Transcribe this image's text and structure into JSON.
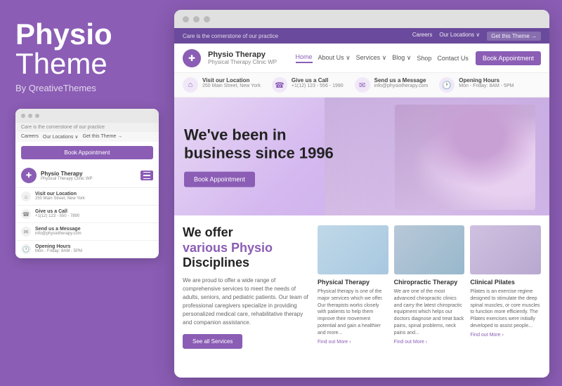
{
  "brand": {
    "physio": "Physio",
    "theme": "Theme",
    "by": "By QreativeThemes"
  },
  "mini_browser": {
    "topbar_text": "Care is the cornerstone of our practice",
    "nav_items": [
      "Careers",
      "Our Locations ∨",
      "Get this Theme →"
    ],
    "book_btn": "Book Appointment",
    "logo_name": "Physio Therapy",
    "logo_sub": "Physical Therapy Clinic WP",
    "info_rows": [
      {
        "label": "Visit our Location",
        "value": "250 Main Street, New York"
      },
      {
        "label": "Give us a Call",
        "value": "+1(12) 123 - 550 - 7890"
      },
      {
        "label": "Send us a Message",
        "value": "info@physiotherapy.com"
      },
      {
        "label": "Opening Hours",
        "value": "Mon - Friday: 8AM - 5PM"
      }
    ]
  },
  "main_site": {
    "topbar": {
      "tagline": "Care is the cornerstone of our practice",
      "nav": [
        "Careers",
        "Our Locations ∨",
        "Get this Theme →"
      ]
    },
    "header": {
      "logo_name": "Physio Therapy",
      "logo_sub": "Physical Therapy Clinic WP",
      "nav": [
        "Home",
        "About Us ∨",
        "Services ∨",
        "Blog ∨",
        "Shop",
        "Contact Us"
      ],
      "book_btn": "Book Appointment"
    },
    "info_bar": [
      {
        "icon": "📍",
        "label": "Visit our Location",
        "value": "250 Main Street, New York"
      },
      {
        "icon": "📞",
        "label": "Give us a Call",
        "value": "+1(12) 123 - 556 - 1990"
      },
      {
        "icon": "✉",
        "label": "Send us a Message",
        "value": "info@physiotherapy.com"
      },
      {
        "icon": "🕐",
        "label": "Opening Hours",
        "value": "Mon - Friday: 8AM - 5PM"
      }
    ],
    "hero": {
      "title": "We've been in business since 1996",
      "cta": "Book Appointment"
    },
    "services": {
      "title_line1": "We offer",
      "title_line2": "various Physio",
      "title_line3": "Disciplines",
      "description": "We are proud to offer a wide range of comprehensive services to meet the needs of adults, seniors, and pediatric patients. Our team of professional caregivers specialize in providing personalized medical care, rehabilitative therapy and companion assistance.",
      "see_all_btn": "See all Services",
      "cards": [
        {
          "title": "Physical Therapy",
          "description": "Physical therapy is one of the major services which we offer. Our therapists works closely with patients to help them improve their movement potential and gain a healthier and more...",
          "link": "Find out More ›"
        },
        {
          "title": "Chiropractic Therapy",
          "description": "We are one of the most advanced chiropractic clinics and carry the latest chiropractic equipment which helps our doctors diagnose and treat back pains, spinal problems, neck pains and...",
          "link": "Find out More ›"
        },
        {
          "title": "Clinical Pilates",
          "description": "Pilates is an exercise regime designed to stimulate the deep spinal muscles, or core muscles to function more efficiently. The Pilates exercises were initially developed to assist people...",
          "link": "Find out More ›"
        }
      ]
    }
  },
  "colors": {
    "primary": "#8B5DB5",
    "text_dark": "#222",
    "text_mid": "#555",
    "text_light": "#888"
  }
}
